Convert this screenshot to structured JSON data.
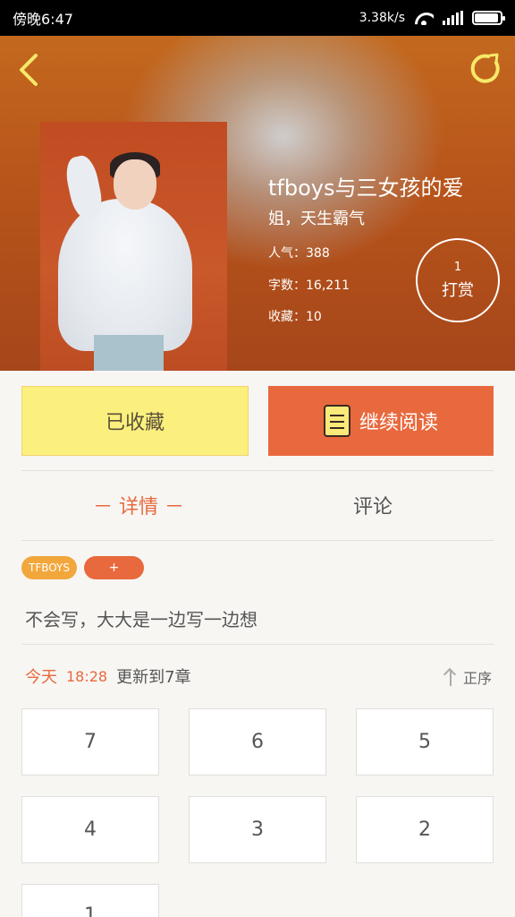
{
  "status_bar": {
    "carrier": "傍晚6:47",
    "speed": "3.38k/s"
  },
  "header": {
    "title": "tfboys与三女孩的爱",
    "subtitle": "姐，天生霸气",
    "popularity": "人气：388",
    "word_count": "字数：16,211",
    "favorites": "收藏：10",
    "tip_count": "1",
    "tip_label": "打赏"
  },
  "actions": {
    "favorited_label": "已收藏",
    "continue_label": "继续阅读"
  },
  "tabs": [
    {
      "label": "－ 详情 －"
    },
    {
      "label": "评论"
    }
  ],
  "tags": [
    "TFBOYS",
    "+"
  ],
  "description": "不会写，大大是一边写一边想",
  "update": {
    "today": "今天",
    "time": "18:28",
    "text": "更新到7章"
  },
  "sort_label": "正序",
  "chapters": [
    "7",
    "6",
    "5",
    "4",
    "3",
    "2",
    "1"
  ],
  "colors": {
    "accent": "#e8693d",
    "favorite_bg": "#fbf07d",
    "tag_yellow": "#f2a73c"
  },
  "icons": [
    "back-arrow-icon",
    "refresh-icon",
    "book-icon",
    "sort-arrow-icon",
    "wifi-icon",
    "signal-icon",
    "battery-icon"
  ]
}
